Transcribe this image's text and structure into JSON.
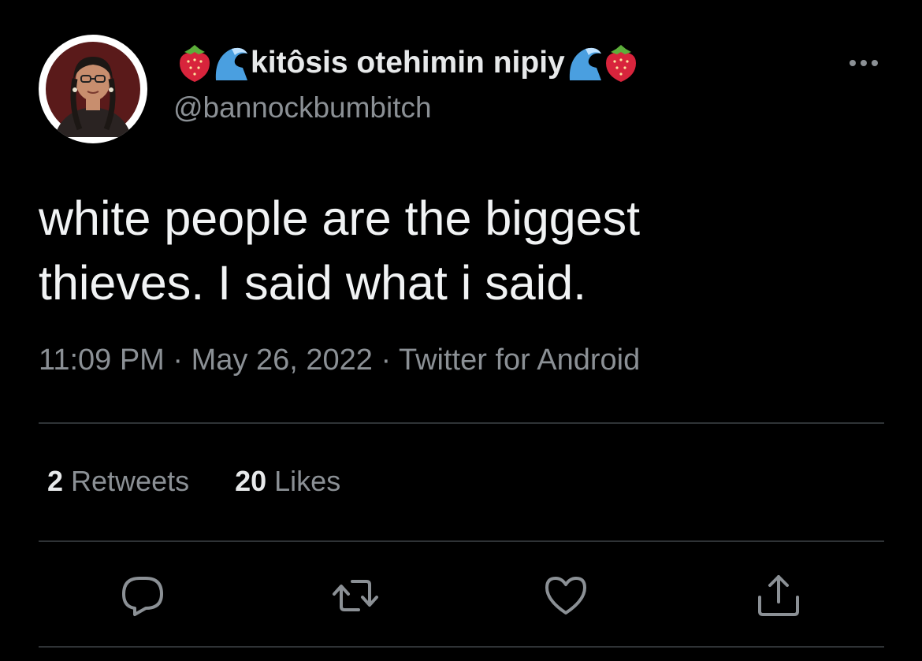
{
  "author": {
    "display_name": "kitôsis otehimin nipiy",
    "handle": "@bannockbumbitch",
    "name_emojis_left": [
      "strawberry-emoji",
      "wave-emoji"
    ],
    "name_emojis_right": [
      "wave-emoji",
      "strawberry-emoji"
    ]
  },
  "tweet": {
    "text": "white people are the biggest\nthieves. I said what i said.",
    "time": "11:09 PM",
    "date": "May 26, 2022",
    "source": "Twitter for Android",
    "separator": " · "
  },
  "stats": {
    "retweets_count": "2",
    "retweets_label": " Retweets",
    "likes_count": "20",
    "likes_label": " Likes"
  },
  "actions": [
    "reply-icon",
    "retweet-icon",
    "like-icon",
    "share-icon"
  ],
  "colors": {
    "background": "#000000",
    "primary_text": "#e7e9ea",
    "secondary_text": "#8b9095",
    "divider": "#2f3336",
    "icon": "#8b9095"
  }
}
